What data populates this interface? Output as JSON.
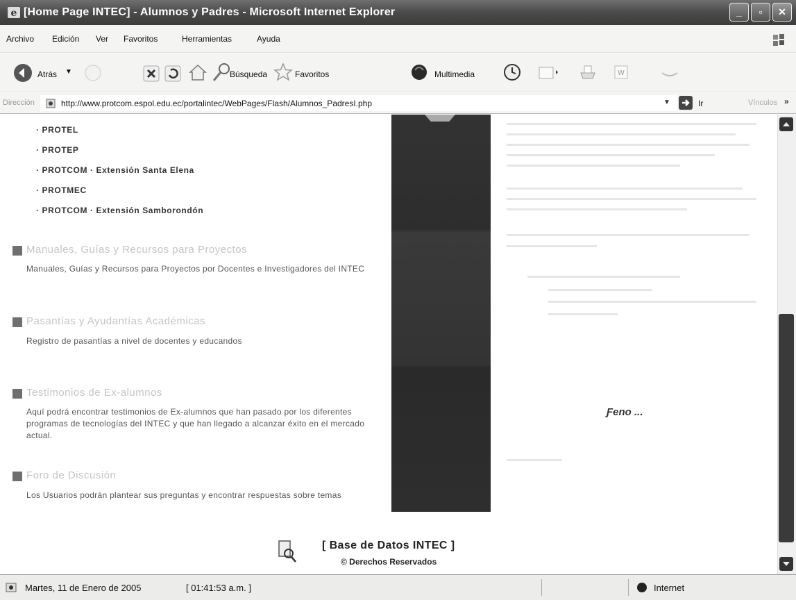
{
  "window": {
    "title": "[Home Page INTEC] - Alumnos y Padres - Microsoft Internet Explorer",
    "min": "_",
    "max": "▫",
    "close": "✕"
  },
  "menu": [
    "Archivo",
    "Edición",
    "Ver",
    "Favoritos",
    "Herramientas",
    "Ayuda"
  ],
  "toolbar": {
    "back": "Atrás",
    "search": "Búsqueda",
    "favorites": "Favoritos",
    "media": "Multimedia"
  },
  "address": {
    "label": "Dirección",
    "url": "http://www.protcom.espol.edu.ec/portalintec/WebPages/Flash/Alumnos_PadresI.php",
    "go": "Ir",
    "links": "Vínculos",
    "links_chevron": "»"
  },
  "content": {
    "programs": [
      "· PROTEL",
      "· PROTEP",
      "· PROTCOM · Extensión Santa Elena",
      "· PROTMEC",
      "· PROTCOM · Extensión Samborondón"
    ],
    "sections": [
      {
        "title": "Manuales, Guías y Recursos para Proyectos",
        "desc": "Manuales, Guías y Recursos para Proyectos por Docentes e Investigadores del INTEC"
      },
      {
        "title": "Pasantías y Ayudantías Académicas",
        "desc": "Registro de pasantías a nivel de docentes y educandos"
      },
      {
        "title": "Testimonios de Ex-alumnos",
        "desc": "Aquí podrá encontrar testimonios de Ex-alumnos que han pasado por los diferentes programas de tecnologías del INTEC y que han llegado a alcanzar éxito en el mercado actual."
      },
      {
        "title": "Foro de Discusión",
        "desc": "Los Usuarios podrán plantear sus preguntas y encontrar respuestas sobre temas"
      }
    ],
    "logo": "Ƒeno ...",
    "footer_title": "[ Base de Datos INTEC ]",
    "footer_copy": "© Derechos Reservados"
  },
  "status": {
    "date": "Martes, 11 de Enero de 2005",
    "time": "[ 01:41:53 a.m. ]",
    "zone": "Internet"
  }
}
